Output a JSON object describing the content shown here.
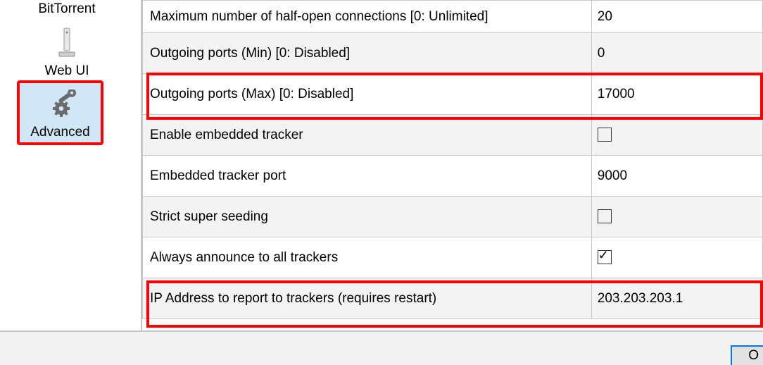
{
  "sidebar": {
    "bittorrent_label": "BitTorrent",
    "webui_label": "Web UI",
    "advanced_label": "Advanced"
  },
  "settings": {
    "rows": [
      {
        "label": "Maximum number of half-open connections [0: Unlimited]",
        "value": "20",
        "type": "text"
      },
      {
        "label": "Outgoing ports (Min) [0: Disabled]",
        "value": "0",
        "type": "text"
      },
      {
        "label": "Outgoing ports (Max) [0: Disabled]",
        "value": "17000",
        "type": "text"
      },
      {
        "label": "Enable embedded tracker",
        "value": false,
        "type": "check"
      },
      {
        "label": "Embedded tracker port",
        "value": "9000",
        "type": "text"
      },
      {
        "label": "Strict super seeding",
        "value": false,
        "type": "check"
      },
      {
        "label": "Always announce to all trackers",
        "value": true,
        "type": "check"
      },
      {
        "label": "IP Address to report to trackers (requires restart)",
        "value": "203.203.203.1",
        "type": "text"
      }
    ]
  },
  "footer": {
    "button_partial": "O"
  },
  "highlights": {
    "sidebar_advanced": true,
    "row_outgoing_max": true,
    "row_ip_address": true
  }
}
